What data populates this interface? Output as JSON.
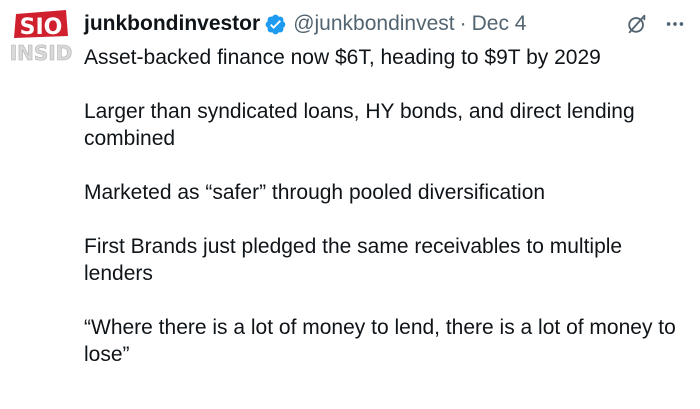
{
  "tweet": {
    "author": {
      "display_name": "junkbondinvestor",
      "handle": "@junkbondinvest",
      "verified": true,
      "avatar": {
        "line1": "SIO",
        "line2": "INSID"
      }
    },
    "separator": "·",
    "date": "Dec 4",
    "paragraphs": [
      "Asset-backed finance now $6T, heading to $9T by 2029",
      "Larger than syndicated loans, HY bonds, and direct lending combined",
      "Marketed as “safer” through pooled diversification",
      "First Brands just pledged the same receivables to multiple lenders",
      "“Where there is a lot of money to lend, there is a lot of money to lose”"
    ]
  },
  "icons": {
    "verified": "verified-badge-icon",
    "grok": "grok-icon",
    "more": "more-icon"
  },
  "colors": {
    "text": "#0f1419",
    "muted": "#536471",
    "verified": "#1d9bf0",
    "avatar_red": "#d0202e"
  }
}
